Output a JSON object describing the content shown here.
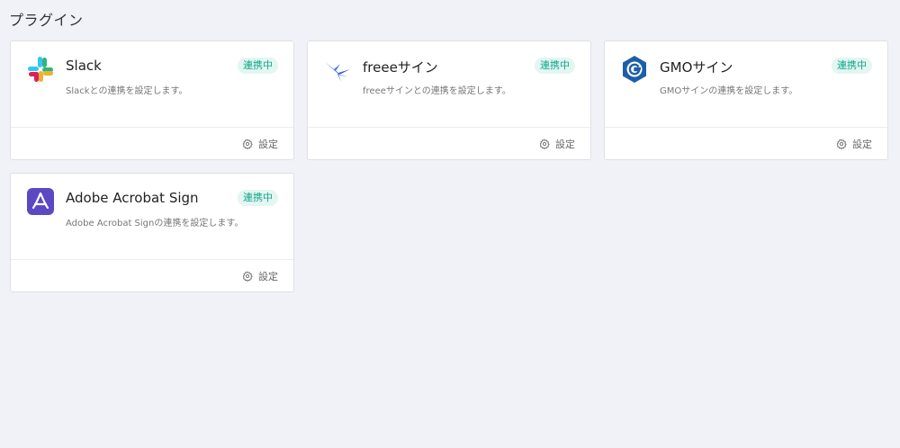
{
  "page": {
    "title": "プラグイン"
  },
  "plugins": [
    {
      "name": "Slack",
      "badge": "連携中",
      "description": "Slackとの連携を設定します。",
      "settings_label": "設定",
      "icon": "slack-icon"
    },
    {
      "name": "freeeサイン",
      "badge": "連携中",
      "description": "freeeサインとの連携を設定します。",
      "settings_label": "設定",
      "icon": "freee-sign-icon"
    },
    {
      "name": "GMOサイン",
      "badge": "連携中",
      "description": "GMOサインの連携を設定します。",
      "settings_label": "設定",
      "icon": "gmo-sign-icon"
    },
    {
      "name": "Adobe Acrobat Sign",
      "badge": "連携中",
      "description": "Adobe Acrobat Signの連携を設定します。",
      "settings_label": "設定",
      "icon": "adobe-acrobat-sign-icon"
    }
  ],
  "colors": {
    "background": "#f1f1f8",
    "badge_bg": "#e3f6f2",
    "badge_text": "#13a58a",
    "adobe": "#5b48c2",
    "gmo": "#1d5ea8",
    "freee": "#2f5fd0"
  }
}
